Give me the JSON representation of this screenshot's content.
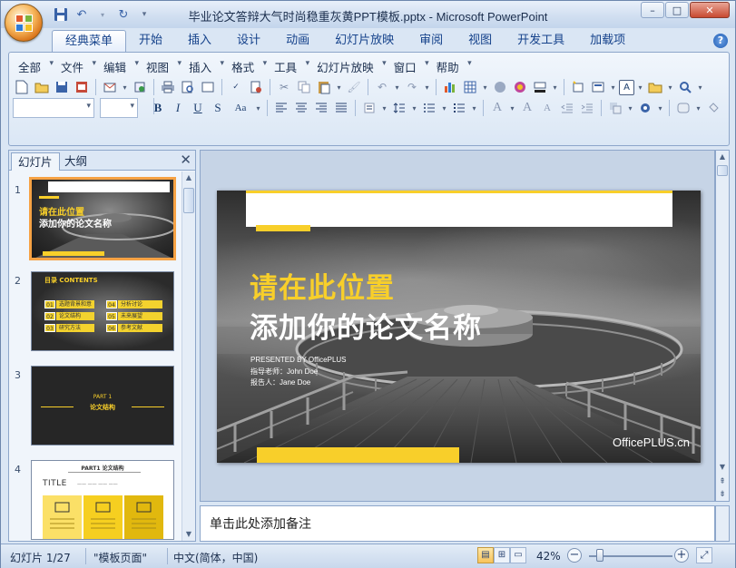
{
  "window": {
    "title": "毕业论文答辩大气时尚稳重灰黄PPT模板.pptx - Microsoft PowerPoint",
    "controls": {
      "minimize": "–",
      "maximize": "□",
      "close": "✕"
    }
  },
  "quick_access": [
    {
      "name": "save-icon",
      "glyph": "💾"
    },
    {
      "name": "undo-icon",
      "glyph": "↶"
    },
    {
      "name": "redo-icon",
      "glyph": "↷"
    },
    {
      "name": "customize-icon",
      "glyph": "▾"
    }
  ],
  "tabs": [
    "经典菜单",
    "开始",
    "插入",
    "设计",
    "动画",
    "幻灯片放映",
    "审阅",
    "视图",
    "开发工具",
    "加载项"
  ],
  "active_tab": "经典菜单",
  "help_glyph": "?",
  "classic_menu": [
    "全部",
    "文件",
    "编辑",
    "视图",
    "插入",
    "格式",
    "工具",
    "幻灯片放映",
    "窗口",
    "帮助"
  ],
  "format_buttons": {
    "bold": "B",
    "italic": "I",
    "underline": "U",
    "strike": "S",
    "case": "Aa",
    "font_grow": "A",
    "font_shrink": "A"
  },
  "left_pane": {
    "tabs": [
      "幻灯片",
      "大纲"
    ],
    "close_glyph": "✕",
    "slides": [
      {
        "num": "1",
        "line1": "请在此位置",
        "line2": "添加你的论文名称"
      },
      {
        "num": "2",
        "title": "目录 CONTENTS",
        "items": [
          {
            "n": "01",
            "label": "选题背景和意义"
          },
          {
            "n": "04",
            "label": "分析讨论"
          },
          {
            "n": "02",
            "label": "论文结构"
          },
          {
            "n": "05",
            "label": "未来展望"
          },
          {
            "n": "03",
            "label": "研究方法"
          },
          {
            "n": "06",
            "label": "参考文献"
          }
        ]
      },
      {
        "num": "3",
        "part": "PART 1",
        "title": "论文结构"
      },
      {
        "num": "4",
        "header": "PART1 论文结构",
        "title": "TITLE"
      }
    ]
  },
  "slide": {
    "line1": "请在此位置",
    "line2": "添加你的论文名称",
    "presented_by": "PRESENTED BY OfficePLUS",
    "advisor": "指导老师：John Doe",
    "reporter": "报告人：Jane Doe",
    "logo_text": "OfficePLUS.cn"
  },
  "notes_placeholder": "单击此处添加备注",
  "status": {
    "slide_counter": "幻灯片 1/27",
    "theme": "\"模板页面\"",
    "language": "中文(简体，中国)",
    "zoom": "42%",
    "zoom_minus": "−",
    "zoom_plus": "+"
  },
  "colors": {
    "accent_yellow": "#f8cf2a",
    "ribbon_blue": "#dae6f4",
    "selection_orange": "#f6a244"
  }
}
